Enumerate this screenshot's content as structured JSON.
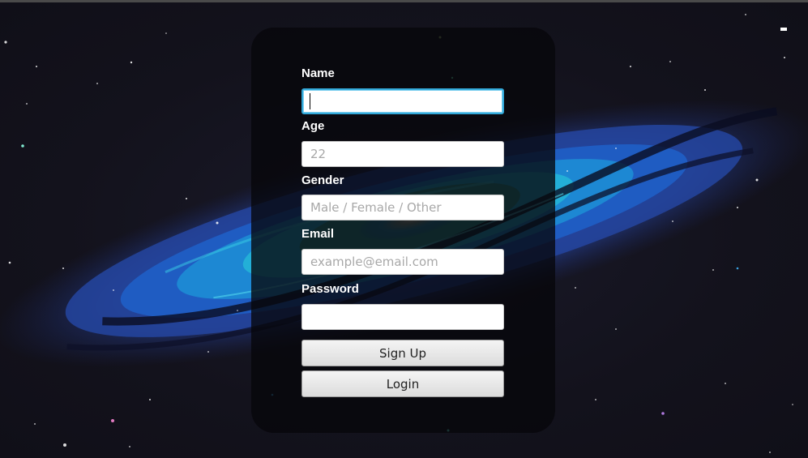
{
  "form": {
    "name": {
      "label": "Name",
      "value": "",
      "placeholder": ""
    },
    "age": {
      "label": "Age",
      "value": "",
      "placeholder": "22"
    },
    "gender": {
      "label": "Gender",
      "value": "",
      "placeholder": "Male / Female / Other"
    },
    "email": {
      "label": "Email",
      "value": "",
      "placeholder": "example@email.com"
    },
    "password": {
      "label": "Password",
      "value": "",
      "placeholder": ""
    }
  },
  "buttons": {
    "signup_label": "Sign Up",
    "login_label": "Login"
  },
  "colors": {
    "background": "#14121e",
    "panel": "#06060a",
    "focus_border": "#31a8d9",
    "galaxy_blue": "#1e6fd0",
    "galaxy_cyan": "#2fd0e0"
  },
  "background_image": {
    "subject": "pixel-art spiral galaxy"
  }
}
